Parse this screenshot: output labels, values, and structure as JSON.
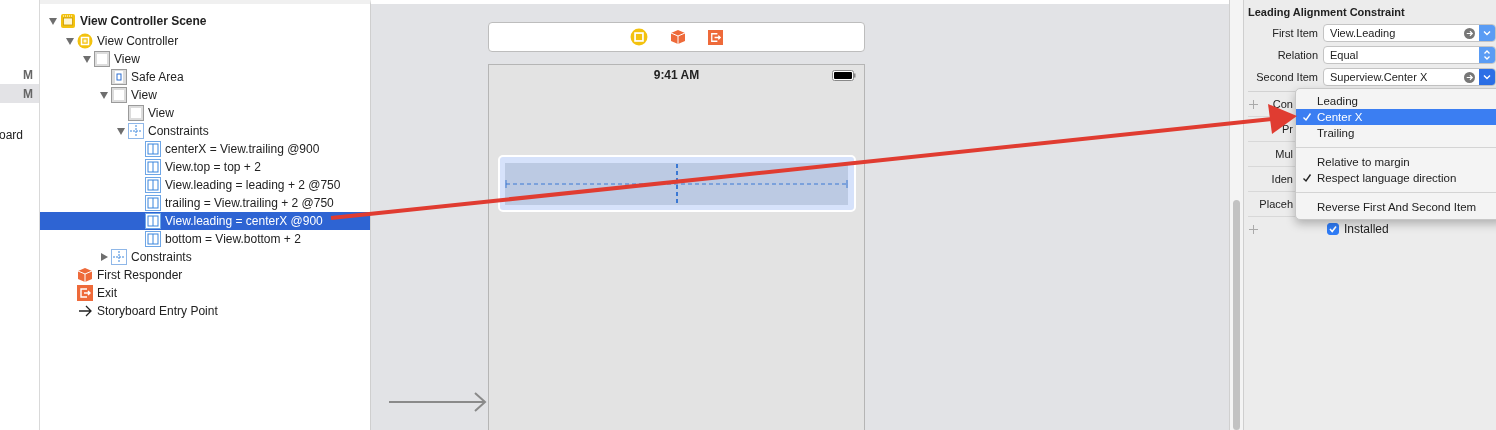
{
  "navigator": [
    {
      "badge": "M",
      "selected": false
    },
    {
      "badge": "M",
      "selected": true
    },
    {
      "label": "oard",
      "selected": false
    }
  ],
  "tree": [
    {
      "label": "View Controller Scene",
      "kind": "scene",
      "expanded": true,
      "selected": false,
      "children": [
        {
          "label": "View Controller",
          "kind": "controller",
          "expanded": true,
          "selected": false,
          "children": [
            {
              "label": "View",
              "kind": "view",
              "expanded": true,
              "selected": false,
              "children": [
                {
                  "label": "Safe Area",
                  "kind": "safe_area",
                  "selected": false
                },
                {
                  "label": "View",
                  "kind": "view",
                  "expanded": true,
                  "selected": false,
                  "children": [
                    {
                      "label": "View",
                      "kind": "view",
                      "selected": false
                    },
                    {
                      "label": "Constraints",
                      "kind": "constraints",
                      "expanded": true,
                      "selected": false,
                      "children": [
                        {
                          "label": "centerX = View.trailing @900",
                          "kind": "constraint",
                          "selected": false
                        },
                        {
                          "label": "View.top = top + 2",
                          "kind": "constraint",
                          "selected": false
                        },
                        {
                          "label": "View.leading = leading + 2 @750",
                          "kind": "constraint",
                          "selected": false
                        },
                        {
                          "label": "trailing = View.trailing + 2 @750",
                          "kind": "constraint",
                          "selected": false
                        },
                        {
                          "label": "View.leading = centerX @900",
                          "kind": "constraint",
                          "selected": true
                        },
                        {
                          "label": "bottom = View.bottom + 2",
                          "kind": "constraint",
                          "selected": false
                        }
                      ]
                    }
                  ]
                },
                {
                  "label": "Constraints",
                  "kind": "constraints",
                  "expanded": false,
                  "selected": false
                }
              ]
            }
          ]
        },
        {
          "label": "First Responder",
          "kind": "responder",
          "selected": false
        },
        {
          "label": "Exit",
          "kind": "exit",
          "selected": false
        },
        {
          "label": "Storyboard Entry Point",
          "kind": "entry",
          "selected": false
        }
      ]
    }
  ],
  "canvas": {
    "status_time": "9:41 AM"
  },
  "inspector": {
    "title": "Leading Alignment Constraint",
    "fields": [
      {
        "label": "First Item",
        "value": "View.Leading",
        "kind": "item",
        "active": false
      },
      {
        "label": "Relation",
        "value": "Equal",
        "kind": "popup",
        "active": false
      },
      {
        "label": "Second Item",
        "value": "Superview.Center X",
        "kind": "item",
        "active": true
      }
    ],
    "rows": [
      {
        "label": "Con",
        "addable": true
      },
      {
        "label": "Pr",
        "addable": false
      },
      {
        "label": "Mul",
        "addable": false
      },
      {
        "label": "Iden",
        "addable": false
      },
      {
        "label": "Placeh",
        "addable": false
      }
    ],
    "installed": {
      "label": "Installed",
      "checked": true,
      "addable": true
    },
    "menu": [
      [
        {
          "label": "Leading",
          "checked": false,
          "selected": false
        },
        {
          "label": "Center X",
          "checked": true,
          "selected": true
        },
        {
          "label": "Trailing",
          "checked": false,
          "selected": false
        }
      ],
      [
        {
          "label": "Relative to margin",
          "checked": false,
          "selected": false
        },
        {
          "label": "Respect language direction",
          "checked": true,
          "selected": false
        }
      ],
      [
        {
          "label": "Reverse First And Second Item",
          "checked": false,
          "selected": false
        }
      ]
    ]
  }
}
